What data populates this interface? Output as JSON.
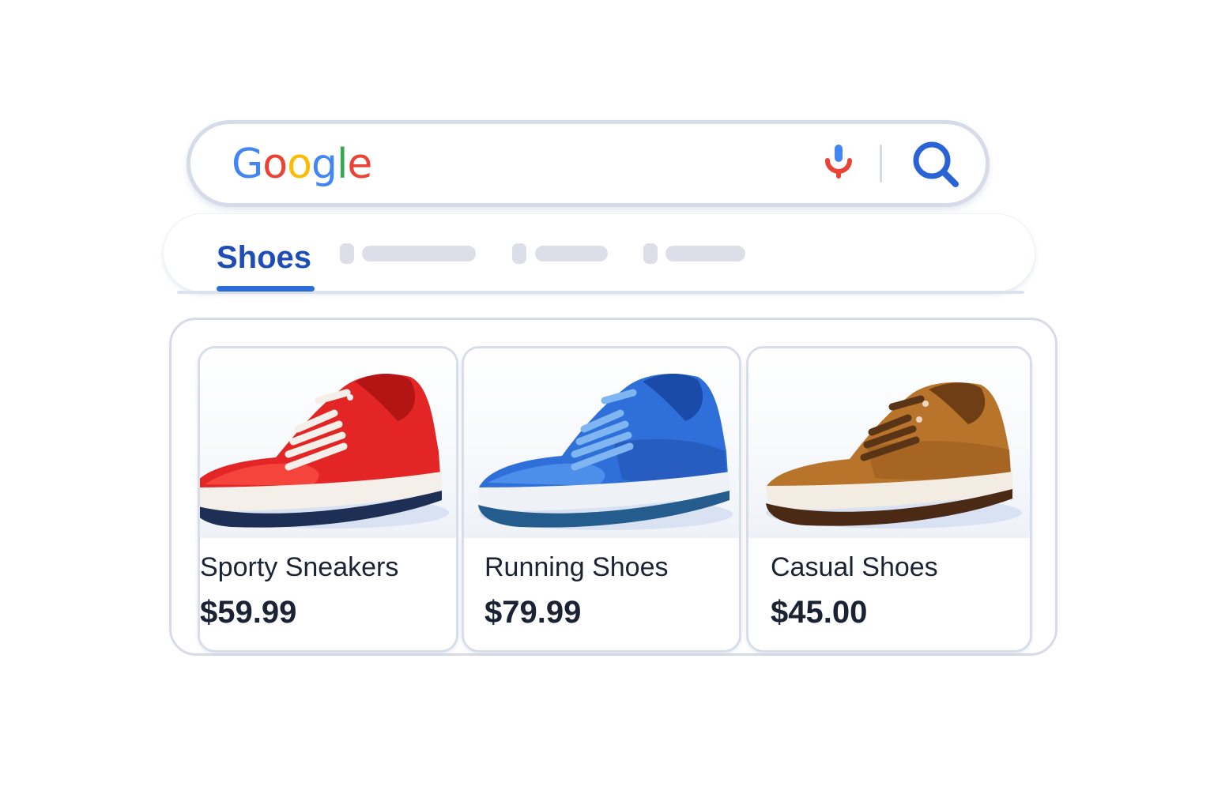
{
  "search": {
    "logo_letters": [
      {
        "char": "G",
        "color": "#4285F4"
      },
      {
        "char": "o",
        "color": "#EA4335"
      },
      {
        "char": "o",
        "color": "#FBBC05"
      },
      {
        "char": "g",
        "color": "#4285F4"
      },
      {
        "char": "l",
        "color": "#34A853"
      },
      {
        "char": "e",
        "color": "#EA4335"
      }
    ],
    "mic_icon": "mic-icon",
    "search_icon": "search-icon"
  },
  "tabs": {
    "active_label": "Shoes",
    "active_color": "#1E4DB7",
    "placeholder_tabs": 3
  },
  "products": [
    {
      "title": "Sporty Sneakers",
      "price": "$59.99",
      "shoe_color": "#E42525"
    },
    {
      "title": "Running Shoes",
      "price": "$79.99",
      "shoe_color": "#2E6FD9"
    },
    {
      "title": "Casual Shoes",
      "price": "$45.00",
      "shoe_color": "#B8742A"
    }
  ]
}
